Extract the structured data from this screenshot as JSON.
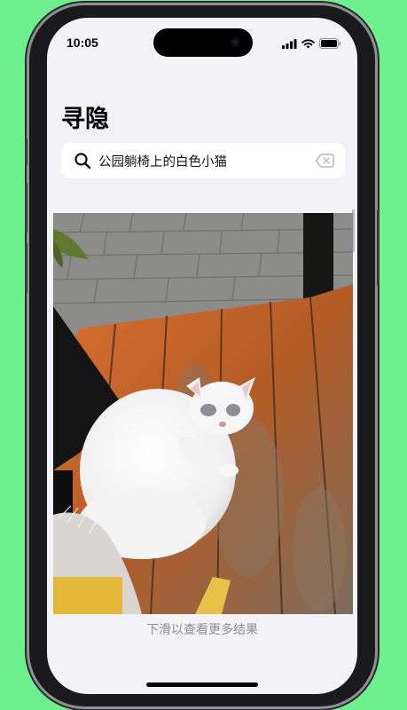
{
  "status_bar": {
    "time": "10:05"
  },
  "app": {
    "title": "寻隐"
  },
  "search": {
    "value": "公园躺椅上的白色小猫"
  },
  "hint": "下滑以查看更多结果",
  "icons": {
    "search": "magnifier-icon",
    "clear": "delete-left-icon",
    "signal": "cellular-signal-icon",
    "wifi": "wifi-icon",
    "battery": "battery-icon"
  },
  "colors": {
    "background": "#6ef08f",
    "screen": "#f2f2f7",
    "hint": "#8e8e93"
  }
}
